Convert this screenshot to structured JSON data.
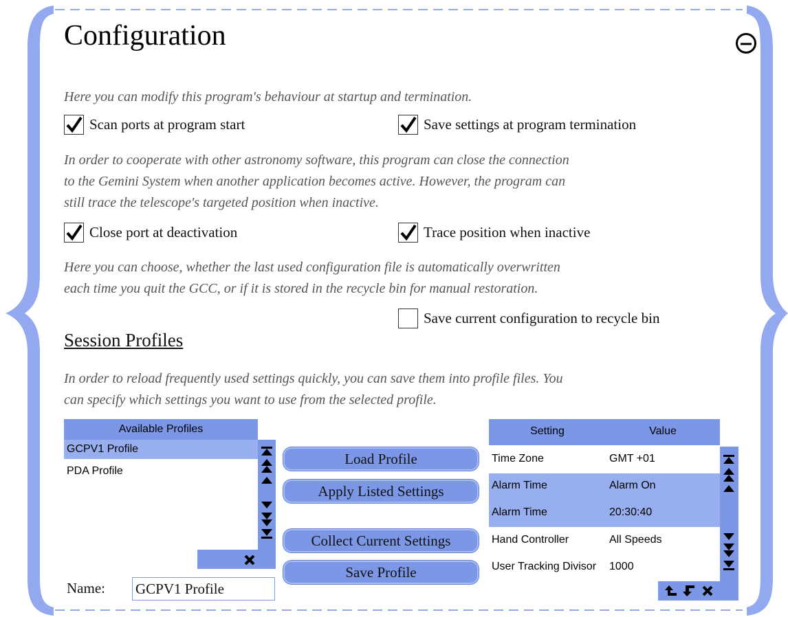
{
  "title": "Configuration",
  "intro": "Here you can modify this program's behaviour at startup and termination.",
  "checkboxes_startup": [
    {
      "label": "Scan ports at program start",
      "checked": true
    },
    {
      "label": "Save settings at program termination",
      "checked": true
    }
  ],
  "coop_text": [
    "In order to cooperate with other astronomy software, this program can close the connection",
    "to the Gemini System when another application becomes active. However, the program can",
    "still trace the telescope's targeted position when inactive."
  ],
  "checkboxes_coop": [
    {
      "label": "Close port at deactivation",
      "checked": true
    },
    {
      "label": "Trace position when inactive",
      "checked": true
    }
  ],
  "recycle_text": [
    "Here you can choose, whether the last used configuration file is automatically overwritten",
    "each time you quit the GCC, or if it is stored in the recycle bin for manual restoration."
  ],
  "recycle_checkbox": {
    "label": "Save current configuration to recycle bin",
    "checked": false
  },
  "session": {
    "heading": "Session Profiles",
    "text": [
      "In order to reload frequently used settings quickly, you can save them into profile files. You",
      "can specify which settings you want to use from the selected profile."
    ],
    "profiles_header": "Available Profiles",
    "profiles": [
      "GCPV1 Profile",
      "PDA Profile"
    ],
    "selected_profile": 0,
    "buttons": {
      "load": "Load Profile",
      "apply": "Apply Listed Settings",
      "collect": "Collect Current Settings",
      "save": "Save Profile"
    },
    "name_label": "Name:",
    "name_value": "GCPV1 Profile",
    "settings_headers": {
      "setting": "Setting",
      "value": "Value"
    },
    "settings": [
      {
        "setting": "Time Zone",
        "value": "GMT +01",
        "highlight": false
      },
      {
        "setting": "Alarm Time",
        "value": "Alarm On",
        "highlight": true
      },
      {
        "setting": "Alarm Time",
        "value": "20:30:40",
        "highlight": true
      },
      {
        "setting": "Hand Controller",
        "value": "All Speeds",
        "highlight": false
      },
      {
        "setting": "User Tracking Divisor",
        "value": "1000",
        "highlight": false
      }
    ]
  },
  "colors": {
    "accent": "#7b97e6",
    "selection": "#97aeef",
    "frame": "#93a9ef"
  }
}
